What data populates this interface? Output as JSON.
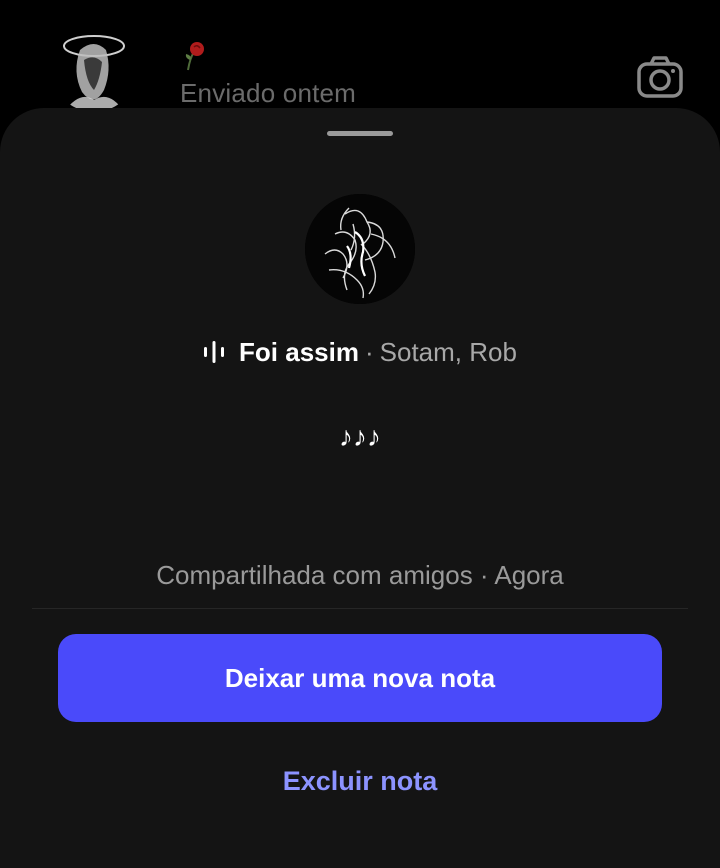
{
  "background_row": {
    "subtitle": "Enviado ontem"
  },
  "note": {
    "track_title": "Foi assim",
    "separator": "·",
    "track_artist": "Sotam, Rob",
    "text": "♪♪♪",
    "meta": "Compartilhada com amigos · Agora"
  },
  "actions": {
    "primary_label": "Deixar uma nova nota",
    "delete_label": "Excluir nota"
  },
  "colors": {
    "accent": "#4a4afa",
    "link": "#8c93ff",
    "sheet": "#141414"
  },
  "icons": [
    "rose-icon",
    "camera-icon",
    "audio-wave-icon"
  ]
}
